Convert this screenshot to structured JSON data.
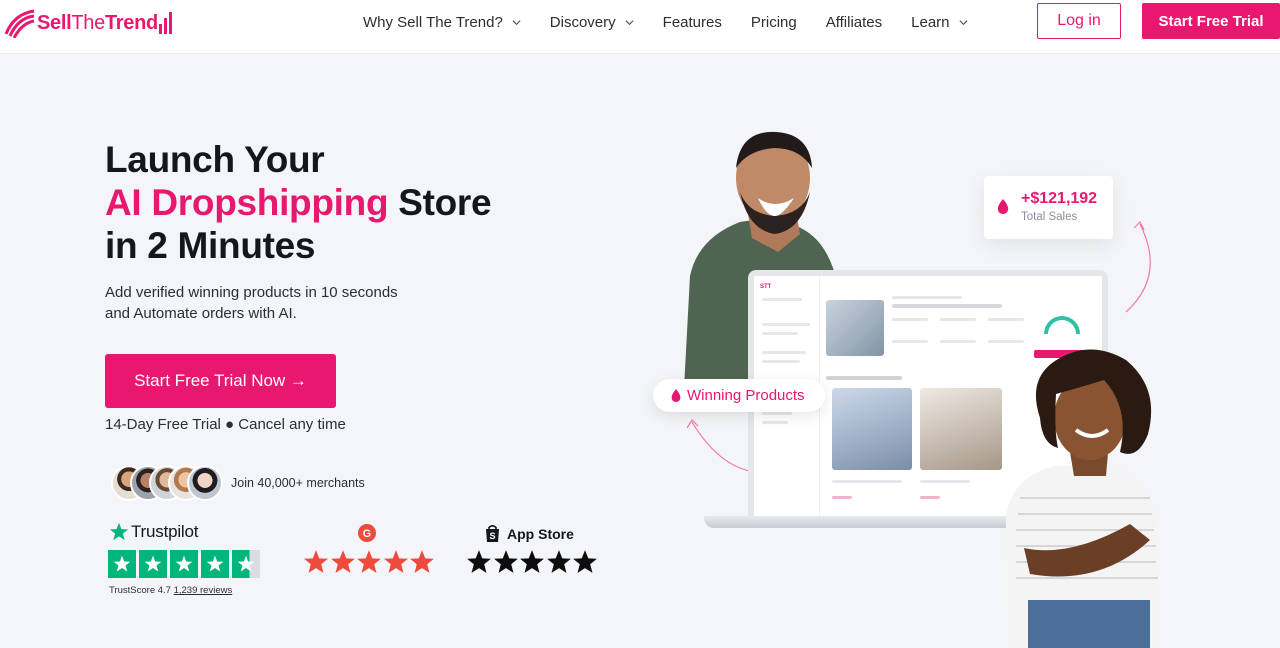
{
  "brand": {
    "name_bold": "Sell",
    "name_thin": "The",
    "name_end": "Trend",
    "color": "#e8176f"
  },
  "nav": {
    "items": [
      {
        "label": "Why Sell The Trend?",
        "dropdown": true
      },
      {
        "label": "Discovery",
        "dropdown": true
      },
      {
        "label": "Features",
        "dropdown": false
      },
      {
        "label": "Pricing",
        "dropdown": false
      },
      {
        "label": "Affiliates",
        "dropdown": false
      },
      {
        "label": "Learn",
        "dropdown": true
      }
    ],
    "login_label": "Log in",
    "trial_label": "Start Free Trial"
  },
  "hero": {
    "headline_line1": "Launch Your",
    "headline_pink": "AI Dropshipping",
    "headline_after_pink": " Store",
    "headline_line3": "in 2 Minutes",
    "subtext_line1": "Add verified winning products in 10 seconds",
    "subtext_line2": "and Automate orders with AI.",
    "cta_label": "Start Free Trial Now →",
    "trial_note": "14-Day Free Trial ● Cancel any time",
    "merchants": "Join 40,000+ merchants"
  },
  "ratings": {
    "trustpilot": {
      "name": "Trustpilot",
      "score_label": "TrustScore 4.7",
      "reviews": "1,239 reviews",
      "score": 4.7
    },
    "g2": {
      "score": 5
    },
    "appstore": {
      "name": "App Store",
      "score": 5
    }
  },
  "visual": {
    "sales_value": "+$121,192",
    "sales_label": "Total Sales",
    "winning_label": "Winning Products"
  }
}
